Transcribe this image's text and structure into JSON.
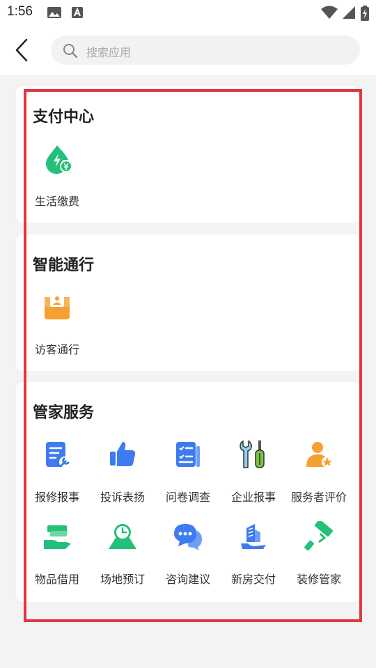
{
  "status_bar": {
    "time": "1:56"
  },
  "search": {
    "placeholder": "搜索应用"
  },
  "sections": [
    {
      "title": "支付中心",
      "items": [
        {
          "label": "生活缴费",
          "icon": "payment-drop-icon"
        }
      ]
    },
    {
      "title": "智能通行",
      "items": [
        {
          "label": "访客通行",
          "icon": "visitor-pass-icon"
        }
      ]
    },
    {
      "title": "管家服务",
      "items": [
        {
          "label": "报修报事",
          "icon": "repair-report-icon"
        },
        {
          "label": "投诉表扬",
          "icon": "thumbs-up-icon"
        },
        {
          "label": "问卷调查",
          "icon": "survey-checklist-icon"
        },
        {
          "label": "企业报事",
          "icon": "tools-icon"
        },
        {
          "label": "服务者评价",
          "icon": "person-star-icon"
        },
        {
          "label": "物品借用",
          "icon": "hand-borrow-icon"
        },
        {
          "label": "场地预订",
          "icon": "venue-clock-icon"
        },
        {
          "label": "咨询建议",
          "icon": "chat-bubbles-icon"
        },
        {
          "label": "新房交付",
          "icon": "building-hand-icon"
        },
        {
          "label": "装修管家",
          "icon": "paint-roller-icon"
        }
      ]
    }
  ],
  "colors": {
    "green": "#23c07a",
    "blue": "#3e7bf0",
    "orange": "#f5a032",
    "highlight": "#e0383e"
  }
}
